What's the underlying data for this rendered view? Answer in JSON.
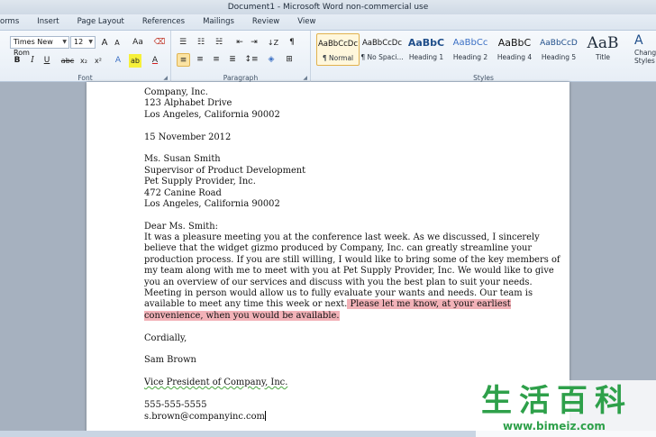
{
  "window": {
    "title": "Document1 - Microsoft Word non-commercial use"
  },
  "ribbon_tabs": [
    "orms",
    "Insert",
    "Page Layout",
    "References",
    "Mailings",
    "Review",
    "View"
  ],
  "font_group": {
    "font_name": "Times New Rom",
    "font_size": "12",
    "label": "Font",
    "grow": "A",
    "shrink": "A",
    "case": "Aa",
    "bold": "B",
    "italic": "I",
    "underline": "U",
    "strike": "abc",
    "subscript": "x₂",
    "superscript": "x²",
    "effects": "A",
    "highlight": "ab",
    "color": "A"
  },
  "paragraph_group": {
    "label": "Paragraph",
    "pilcrow": "¶"
  },
  "styles_group": {
    "label": "Styles",
    "items": [
      {
        "sample": "AaBbCcDc",
        "name": "¶ Normal"
      },
      {
        "sample": "AaBbCcDc",
        "name": "¶ No Spaci..."
      },
      {
        "sample": "AaBbC",
        "name": "Heading 1"
      },
      {
        "sample": "AaBbCc",
        "name": "Heading 2"
      },
      {
        "sample": "AaBbC",
        "name": "Heading 4"
      },
      {
        "sample": "AaBbCcD",
        "name": "Heading 5"
      },
      {
        "sample": "AaB",
        "name": "Title"
      }
    ],
    "change_styles": "Chang Styles"
  },
  "document": {
    "sender": [
      "Company, Inc.",
      "123 Alphabet Drive",
      "Los Angeles, California 90002"
    ],
    "date": "15 November 2012",
    "recipient": [
      "Ms. Susan Smith",
      "Supervisor of Product Development",
      "Pet Supply Provider, Inc.",
      "472 Canine Road",
      "Los Angeles, California 90002"
    ],
    "salutation": "Dear Ms. Smith:",
    "body": [
      "It was a pleasure meeting you at the conference last week. As we discussed, I sincerely",
      "believe that the widget gizmo produced by Company, Inc. can greatly streamline  your",
      "production process. If you are still willing, I would like to bring some of the key members  of",
      "my team along with me to meet with you at Pet Supply Provider, Inc. We would like to give",
      "you an overview of our services  and discuss with you the best plan to suit your needs.",
      "Meeting in person would allow us to fully evaluate your wants and needs. Our team is"
    ],
    "body_line7_plain": "available to meet any time this week or next.",
    "body_line7_highlight": " Please let me know, at your earliest",
    "body_line8_highlight": "convenience, when you would be available.",
    "closing": "Cordially,",
    "name": "Sam Brown",
    "title": "Vice President of Company, Inc.",
    "phone": "555-555-5555",
    "email": "s.brown@companyinc.com"
  },
  "watermark": {
    "chinese": "生活百科",
    "url": "www.bimeiz.com"
  },
  "colors": {
    "highlight": "#f2b2b8",
    "selected_style": "#fff7dc",
    "watermark": "#2ea04a"
  }
}
